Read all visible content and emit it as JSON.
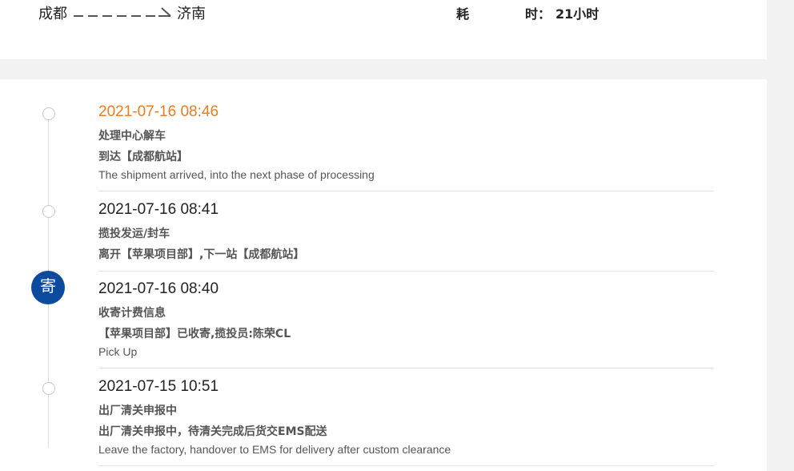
{
  "route": {
    "from": "成都",
    "to": "济南",
    "duration_label_1": "耗",
    "duration_label_2": "时：",
    "duration_value": "21小时"
  },
  "events": [
    {
      "time": "2021-07-16 08:46",
      "status": "处理中心解车",
      "detail": "到达【成都航站】",
      "english": "The shipment arrived, into the next phase of processing"
    },
    {
      "time": "2021-07-16 08:41",
      "status": "揽投发运/封车",
      "detail": "离开【苹果项目部】,下一站【成都航站】",
      "english": ""
    },
    {
      "time": "2021-07-16 08:40",
      "status": "收寄计费信息",
      "detail": "【苹果项目部】已收寄,揽投员:陈荣CL",
      "english": "Pick Up",
      "badge": "寄"
    },
    {
      "time": "2021-07-15 10:51",
      "status": "出厂清关申报中",
      "detail": "出厂清关申报中，待清关完成后货交EMS配送",
      "english": "Leave the factory, handover to EMS for delivery after custom clearance"
    }
  ],
  "colors": {
    "accent_orange": "#e87d22",
    "ems_blue": "#0c4a9e"
  }
}
